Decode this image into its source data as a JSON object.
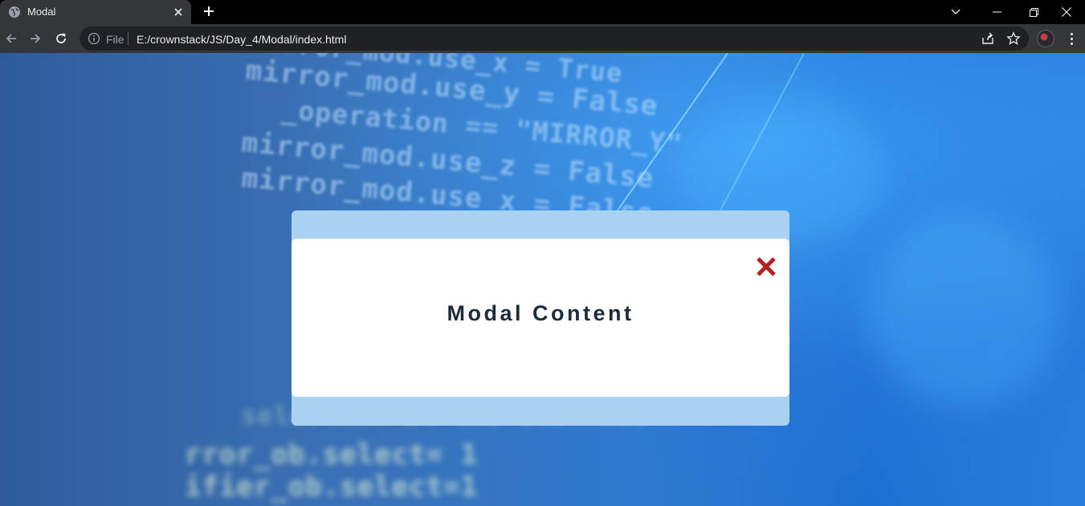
{
  "browser": {
    "tab": {
      "title": "Modal"
    },
    "address_bar": {
      "scheme_label": "File",
      "url": "E:/crownstack/JS/Day_4/Modal/index.html"
    }
  },
  "page": {
    "background_code_lines": [
      "mirror_mod.use_x = True",
      "mirror_mod.use_y = False",
      "_operation == \"MIRROR_Y\"",
      "mirror_mod.use_z = False",
      "mirror_mod.use_x = False",
      "selection at the end -add",
      "rror_ob.select= 1",
      "ifier_ob.select=1"
    ],
    "modal": {
      "content_text": "Modal Content",
      "close_icon_color": "#b22222"
    }
  },
  "colors": {
    "modal_frame": "#a8d1f3",
    "modal_body": "#ffffff",
    "modal_text": "#1d2b3a"
  }
}
